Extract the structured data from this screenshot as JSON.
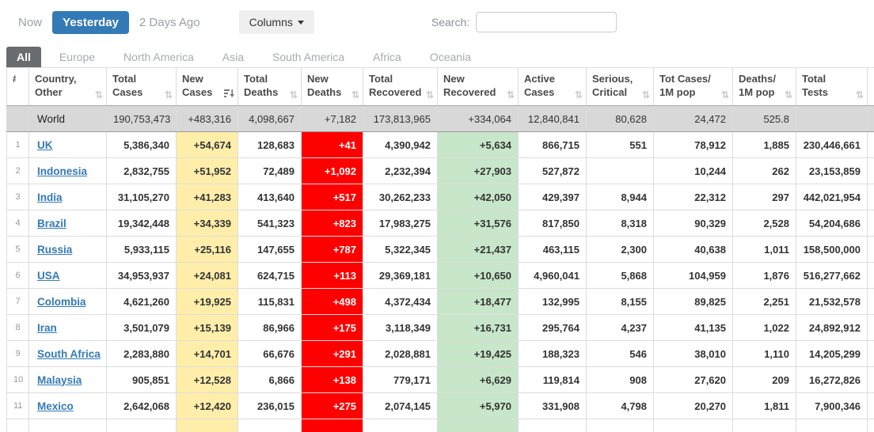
{
  "toolbar": {
    "now_label": "Now",
    "yesterday_label": "Yesterday",
    "two_days_label": "2 Days Ago",
    "columns_label": "Columns",
    "search_label": "Search:",
    "search_value": ""
  },
  "tabs": [
    {
      "label": "All",
      "active": true
    },
    {
      "label": "Europe",
      "active": false
    },
    {
      "label": "North America",
      "active": false
    },
    {
      "label": "Asia",
      "active": false
    },
    {
      "label": "South America",
      "active": false
    },
    {
      "label": "Africa",
      "active": false
    },
    {
      "label": "Oceania",
      "active": false
    }
  ],
  "colors": {
    "accent_blue": "#337ab7",
    "active_tab_gray": "#696d70",
    "new_cases_bg": "#FFEEAA",
    "new_deaths_bg": "#FF0000",
    "new_recovered_bg": "#C8E6C9",
    "world_row_bg": "#d8d8d8"
  },
  "table": {
    "columns": [
      {
        "lines": [
          "#"
        ],
        "sortable": false,
        "sort": "none"
      },
      {
        "lines": [
          "Country,",
          "Other"
        ],
        "sortable": true,
        "sort": "none"
      },
      {
        "lines": [
          "Total",
          "Cases"
        ],
        "sortable": true,
        "sort": "none"
      },
      {
        "lines": [
          "New",
          "Cases"
        ],
        "sortable": true,
        "sort": "desc"
      },
      {
        "lines": [
          "Total",
          "Deaths"
        ],
        "sortable": true,
        "sort": "none"
      },
      {
        "lines": [
          "New",
          "Deaths"
        ],
        "sortable": true,
        "sort": "none"
      },
      {
        "lines": [
          "Total",
          "Recovered"
        ],
        "sortable": true,
        "sort": "none"
      },
      {
        "lines": [
          "New",
          "Recovered"
        ],
        "sortable": true,
        "sort": "none"
      },
      {
        "lines": [
          "Active",
          "Cases"
        ],
        "sortable": true,
        "sort": "none"
      },
      {
        "lines": [
          "Serious,",
          "Critical"
        ],
        "sortable": true,
        "sort": "none"
      },
      {
        "lines": [
          "Tot Cases/",
          "1M pop"
        ],
        "sortable": true,
        "sort": "none"
      },
      {
        "lines": [
          "Deaths/",
          "1M pop"
        ],
        "sortable": true,
        "sort": "none"
      },
      {
        "lines": [
          "Total",
          "Tests"
        ],
        "sortable": true,
        "sort": "none"
      }
    ],
    "world_row": {
      "rank": "",
      "country": "World",
      "total_cases": "190,753,473",
      "new_cases": "+483,316",
      "total_deaths": "4,098,667",
      "new_deaths": "+7,182",
      "total_recovered": "173,813,965",
      "new_recovered": "+334,064",
      "active_cases": "12,840,841",
      "serious_critical": "80,628",
      "cases_per_1m": "24,472",
      "deaths_per_1m": "525.8",
      "total_tests": ""
    },
    "rows": [
      {
        "rank": "1",
        "country": "UK",
        "total_cases": "5,386,340",
        "new_cases": "+54,674",
        "total_deaths": "128,683",
        "new_deaths": "+41",
        "total_recovered": "4,390,942",
        "new_recovered": "+5,634",
        "active_cases": "866,715",
        "serious_critical": "551",
        "cases_per_1m": "78,912",
        "deaths_per_1m": "1,885",
        "total_tests": "230,446,661"
      },
      {
        "rank": "2",
        "country": "Indonesia",
        "total_cases": "2,832,755",
        "new_cases": "+51,952",
        "total_deaths": "72,489",
        "new_deaths": "+1,092",
        "total_recovered": "2,232,394",
        "new_recovered": "+27,903",
        "active_cases": "527,872",
        "serious_critical": "",
        "cases_per_1m": "10,244",
        "deaths_per_1m": "262",
        "total_tests": "23,153,859"
      },
      {
        "rank": "3",
        "country": "India",
        "total_cases": "31,105,270",
        "new_cases": "+41,283",
        "total_deaths": "413,640",
        "new_deaths": "+517",
        "total_recovered": "30,262,233",
        "new_recovered": "+42,050",
        "active_cases": "429,397",
        "serious_critical": "8,944",
        "cases_per_1m": "22,312",
        "deaths_per_1m": "297",
        "total_tests": "442,021,954"
      },
      {
        "rank": "4",
        "country": "Brazil",
        "total_cases": "19,342,448",
        "new_cases": "+34,339",
        "total_deaths": "541,323",
        "new_deaths": "+823",
        "total_recovered": "17,983,275",
        "new_recovered": "+31,576",
        "active_cases": "817,850",
        "serious_critical": "8,318",
        "cases_per_1m": "90,329",
        "deaths_per_1m": "2,528",
        "total_tests": "54,204,686"
      },
      {
        "rank": "5",
        "country": "Russia",
        "total_cases": "5,933,115",
        "new_cases": "+25,116",
        "total_deaths": "147,655",
        "new_deaths": "+787",
        "total_recovered": "5,322,345",
        "new_recovered": "+21,437",
        "active_cases": "463,115",
        "serious_critical": "2,300",
        "cases_per_1m": "40,638",
        "deaths_per_1m": "1,011",
        "total_tests": "158,500,000"
      },
      {
        "rank": "6",
        "country": "USA",
        "total_cases": "34,953,937",
        "new_cases": "+24,081",
        "total_deaths": "624,715",
        "new_deaths": "+113",
        "total_recovered": "29,369,181",
        "new_recovered": "+10,650",
        "active_cases": "4,960,041",
        "serious_critical": "5,868",
        "cases_per_1m": "104,959",
        "deaths_per_1m": "1,876",
        "total_tests": "516,277,662"
      },
      {
        "rank": "7",
        "country": "Colombia",
        "total_cases": "4,621,260",
        "new_cases": "+19,925",
        "total_deaths": "115,831",
        "new_deaths": "+498",
        "total_recovered": "4,372,434",
        "new_recovered": "+18,477",
        "active_cases": "132,995",
        "serious_critical": "8,155",
        "cases_per_1m": "89,825",
        "deaths_per_1m": "2,251",
        "total_tests": "21,532,578"
      },
      {
        "rank": "8",
        "country": "Iran",
        "total_cases": "3,501,079",
        "new_cases": "+15,139",
        "total_deaths": "86,966",
        "new_deaths": "+175",
        "total_recovered": "3,118,349",
        "new_recovered": "+16,731",
        "active_cases": "295,764",
        "serious_critical": "4,237",
        "cases_per_1m": "41,135",
        "deaths_per_1m": "1,022",
        "total_tests": "24,892,912"
      },
      {
        "rank": "9",
        "country": "South Africa",
        "total_cases": "2,283,880",
        "new_cases": "+14,701",
        "total_deaths": "66,676",
        "new_deaths": "+291",
        "total_recovered": "2,028,881",
        "new_recovered": "+19,425",
        "active_cases": "188,323",
        "serious_critical": "546",
        "cases_per_1m": "38,010",
        "deaths_per_1m": "1,110",
        "total_tests": "14,205,299"
      },
      {
        "rank": "10",
        "country": "Malaysia",
        "total_cases": "905,851",
        "new_cases": "+12,528",
        "total_deaths": "6,866",
        "new_deaths": "+138",
        "total_recovered": "779,171",
        "new_recovered": "+6,629",
        "active_cases": "119,814",
        "serious_critical": "908",
        "cases_per_1m": "27,620",
        "deaths_per_1m": "209",
        "total_tests": "16,272,826"
      },
      {
        "rank": "11",
        "country": "Mexico",
        "total_cases": "2,642,068",
        "new_cases": "+12,420",
        "total_deaths": "236,015",
        "new_deaths": "+275",
        "total_recovered": "2,074,145",
        "new_recovered": "+5,970",
        "active_cases": "331,908",
        "serious_critical": "4,798",
        "cases_per_1m": "20,270",
        "deaths_per_1m": "1,811",
        "total_tests": "7,900,346"
      }
    ]
  }
}
